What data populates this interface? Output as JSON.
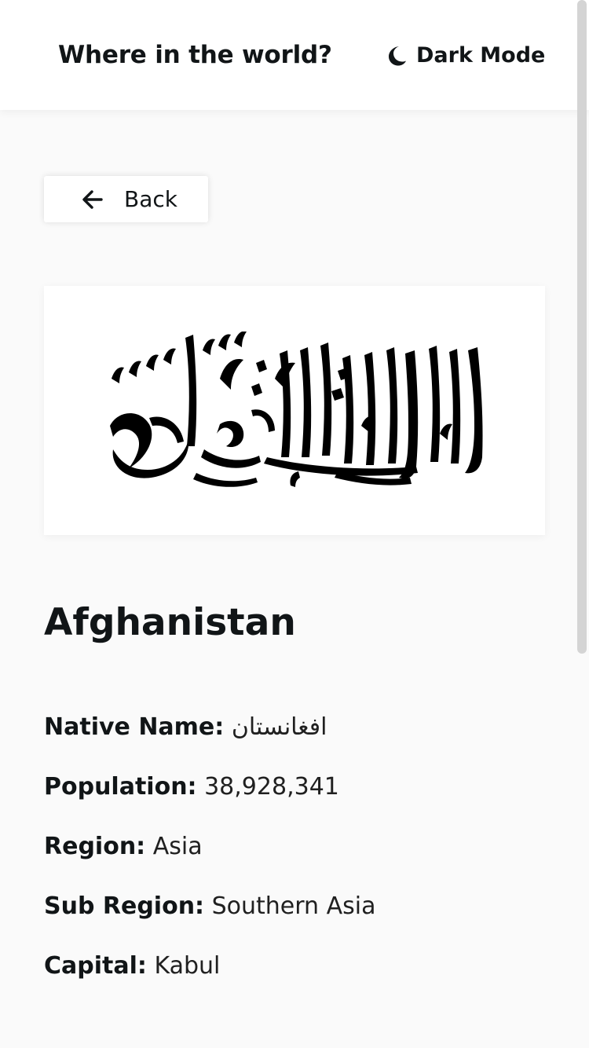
{
  "header": {
    "title": "Where in the world?",
    "dark_mode_label": "Dark Mode",
    "dark_mode_icon": "moon-icon"
  },
  "back": {
    "label": "Back",
    "icon": "arrow-left-icon"
  },
  "country": {
    "name": "Afghanistan",
    "flag_icon": "afghanistan-flag",
    "details": [
      {
        "label": "Native Name:",
        "value": "افغانستان"
      },
      {
        "label": "Population:",
        "value": "38,928,341"
      },
      {
        "label": "Region:",
        "value": "Asia"
      },
      {
        "label": "Sub Region:",
        "value": "Southern Asia"
      },
      {
        "label": "Capital:",
        "value": "Kabul"
      }
    ]
  },
  "colors": {
    "background": "#fafafa",
    "surface": "#ffffff",
    "text": "#111517",
    "flag_ink": "#000000"
  }
}
